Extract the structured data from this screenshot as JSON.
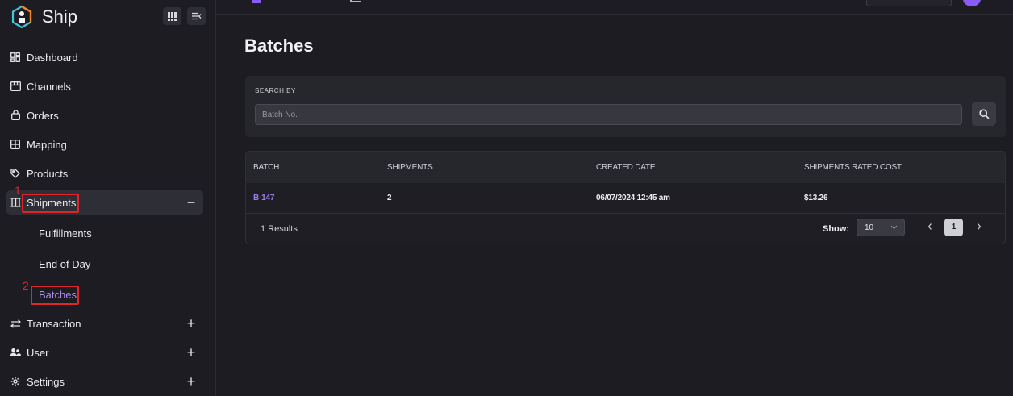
{
  "brand": {
    "name": "Ship"
  },
  "sidebar": {
    "items": [
      {
        "label": "Dashboard",
        "icon": "dashboard-icon"
      },
      {
        "label": "Channels",
        "icon": "store-icon"
      },
      {
        "label": "Orders",
        "icon": "bag-icon"
      },
      {
        "label": "Mapping",
        "icon": "grid-icon"
      },
      {
        "label": "Products",
        "icon": "tag-icon"
      },
      {
        "label": "Shipments",
        "icon": "columns-icon",
        "toggle": "−",
        "expanded": true
      },
      {
        "label": "Transaction",
        "icon": "exchange-icon",
        "toggle": "+"
      },
      {
        "label": "User",
        "icon": "users-icon",
        "toggle": "+"
      },
      {
        "label": "Settings",
        "icon": "gear-icon",
        "toggle": "+"
      }
    ],
    "sub_items": [
      {
        "label": "Fulfillments"
      },
      {
        "label": "End of Day"
      },
      {
        "label": "Batches",
        "active": true
      }
    ]
  },
  "annotations": {
    "one": "1",
    "two": "2",
    "highlight_color": "#e0242a"
  },
  "main": {
    "title": "Batches",
    "search": {
      "label": "SEARCH BY",
      "placeholder": "Batch No."
    },
    "table": {
      "columns": [
        "BATCH",
        "SHIPMENTS",
        "CREATED DATE",
        "SHIPMENTS RATED COST"
      ],
      "rows": [
        {
          "batch": "B-147",
          "shipments": "2",
          "created_date": "06/07/2024 12:45 am",
          "rated_cost": "$13.26"
        }
      ]
    },
    "footer": {
      "results": "1 Results",
      "show_label": "Show:",
      "page_size": "10",
      "current_page": "1"
    }
  },
  "colors": {
    "accent": "#9b7df0",
    "background": "#1c1c22",
    "card": "#26262d"
  }
}
